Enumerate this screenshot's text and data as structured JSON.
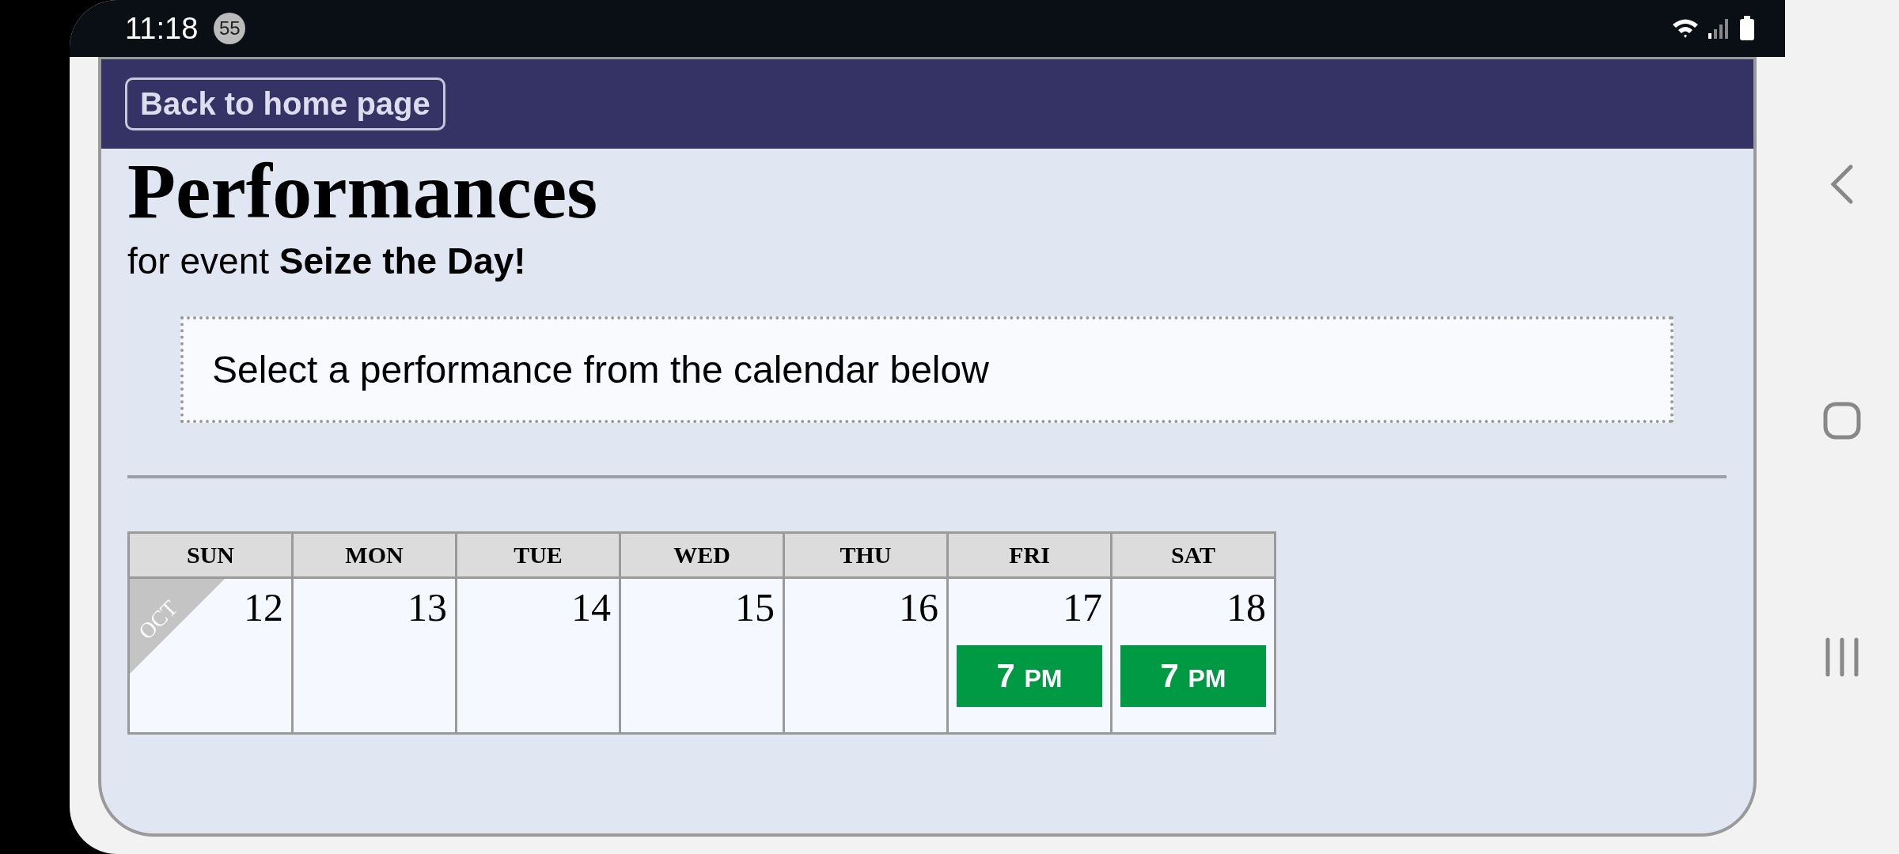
{
  "status_bar": {
    "time": "11:18",
    "notification_count": "55"
  },
  "header": {
    "back_button": "Back to home page"
  },
  "page": {
    "title": "Performances",
    "subtitle": "for event **Seize the Day!**",
    "prompt": "Select a performance from the calendar below"
  },
  "calendar": {
    "weekdays": [
      "SUN",
      "MON",
      "TUE",
      "WED",
      "THU",
      "FRI",
      "SAT"
    ],
    "days": [
      {
        "date": "12",
        "month": "OCT"
      },
      {
        "date": "13"
      },
      {
        "date": "14"
      },
      {
        "date": "15"
      },
      {
        "date": "16"
      },
      {
        "date": "17",
        "performances": [
          {
            "hour": "7",
            "period": "PM"
          }
        ]
      },
      {
        "date": "18",
        "performances": [
          {
            "hour": "7",
            "period": "PM"
          }
        ]
      }
    ]
  }
}
